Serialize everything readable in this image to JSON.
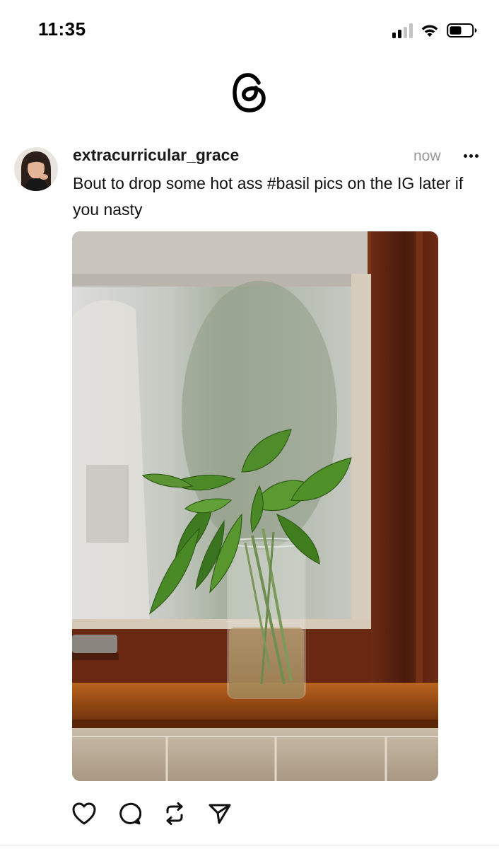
{
  "status_bar": {
    "time": "11:35",
    "icons": [
      "cellular-signal-icon",
      "wifi-icon",
      "battery-icon"
    ]
  },
  "app": {
    "logo_icon": "threads-logo-icon"
  },
  "post": {
    "username": "extracurricular_grace",
    "timestamp": "now",
    "text": "Bout to drop some hot ass #basil pics on the IG later if you nasty",
    "image_icon": "basil-in-jar-on-windowsill-photo",
    "actions": [
      "heart-icon",
      "comment-icon",
      "repost-icon",
      "share-icon"
    ]
  },
  "colors": {
    "text": "#111111",
    "timestamp": "#999999",
    "window_frame": "#5a2312",
    "basil": "#4f8c2a"
  }
}
